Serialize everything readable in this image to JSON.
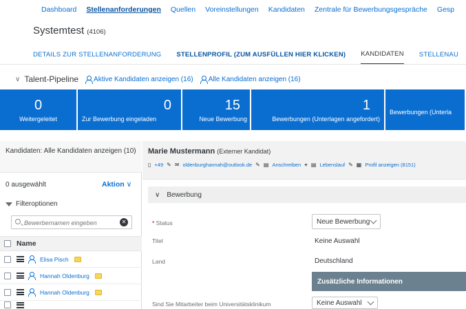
{
  "topnav": {
    "items": [
      "Dashboard",
      "Stellenanforderungen",
      "Quellen",
      "Voreinstellungen",
      "Kandidaten",
      "Zentrale für Bewerbungsgespräche",
      "Gesp"
    ],
    "active_index": 1
  },
  "title": {
    "text": "Systemtest",
    "id": "(4106)"
  },
  "tabs": [
    "DETAILS ZUR STELLENANFORDERUNG",
    "STELLENPROFIL (ZUM AUSFÜLLEN HIER KLICKEN)",
    "KANDIDATEN",
    "STELLENAU"
  ],
  "pipeline": {
    "title": "Talent-Pipeline",
    "active_link": "Aktive Kandidaten anzeigen (16)",
    "all_link": "Alle Kandidaten anzeigen (16)"
  },
  "tiles": {
    "weitergeleitet": {
      "num": "0",
      "label": "Weitergeleitet",
      "value": 0
    },
    "eingeladen": {
      "num": "0",
      "label": "Zur Bewerbung eingeladen",
      "value": 0
    },
    "neue": {
      "num": "15",
      "label": "Neue Bewerbung",
      "value": 15
    },
    "angefordert": {
      "num": "1",
      "label": "Bewerbungen (Unterlagen angefordert)",
      "value": 1
    },
    "unterla": {
      "label": "Bewerbungen (Unterla"
    }
  },
  "left": {
    "header": "Kandidaten: Alle Kandidaten anzeigen (10)",
    "selected": "0 ausgewählt",
    "action": "Aktion",
    "filter": "Filteroptionen",
    "search_placeholder": "Bewerbernamen eingeben",
    "col_name": "Name",
    "candidates": [
      "Elisa Pisch",
      "Hannah Oldenburg",
      "Hannah Oldenburg"
    ]
  },
  "detail": {
    "name": "Marie Mustermann",
    "type": "(Externer Kandidat)",
    "phone": "+49",
    "email": "oldenburghannah@outlook.de",
    "anschreiben": "Anschreiben",
    "lebenslauf": "Lebenslauf",
    "profil": "Profil anzeigen (8151)",
    "section": "Bewerbung",
    "fields": {
      "status_label": "Status",
      "status_value": "Neue Bewerbung",
      "titel_label": "Titel",
      "titel_value": "Keine Auswahl",
      "land_label": "Land",
      "land_value": "Deutschland",
      "zusatz": "Zusätzliche Informationen",
      "mitarbeiter_label": "Sind Sie Mitarbeiter beim Universitätsklinikum",
      "mitarbeiter_value": "Keine Auswahl"
    }
  },
  "colors": {
    "tile_blue": "#0a6ed1",
    "link_blue": "#0a6ed1",
    "zusatz_bg": "#6c8190",
    "badge_yellow": "#f7d65c"
  }
}
